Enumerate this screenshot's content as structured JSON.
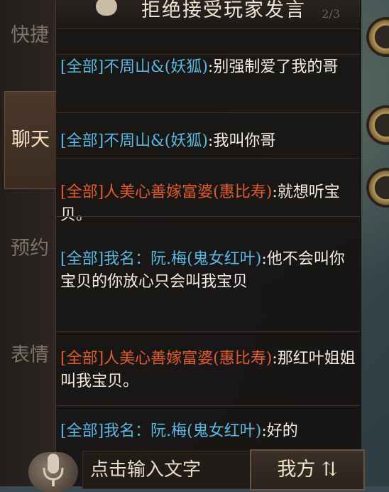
{
  "sidebar": {
    "tabs": [
      {
        "label": "快捷",
        "state": "inactive"
      },
      {
        "label": "聊天",
        "state": "active"
      },
      {
        "label": "预约",
        "state": "inactive"
      },
      {
        "label": "表情",
        "state": "inactive"
      }
    ]
  },
  "header": {
    "title": "拒绝接受玩家发言",
    "page_indicator": "2/3"
  },
  "messages": [
    {
      "channel": "[全部]",
      "sender": "不周山&(妖狐)",
      "sender_color": "blue",
      "text": ":别强制爱了我的哥"
    },
    {
      "channel": "[全部]",
      "sender": "不周山&(妖狐)",
      "sender_color": "blue",
      "text": ":我叫你哥"
    },
    {
      "channel": "[全部]",
      "sender": "人美心善嫁富婆(惠比寿)",
      "sender_color": "red",
      "text": ":就想听宝贝。"
    },
    {
      "channel": "[全部]",
      "sender": "我名：阮.梅(鬼女红叶)",
      "sender_color": "blue",
      "text": ":他不会叫你宝贝的你放心只会叫我宝贝"
    },
    {
      "channel": "[全部]",
      "sender": "人美心善嫁富婆(惠比寿)",
      "sender_color": "red",
      "text": ":那红叶姐姐叫我宝贝。"
    },
    {
      "channel": "[全部]",
      "sender": "我名：阮.梅(鬼女红叶)",
      "sender_color": "blue",
      "text": ":好的"
    }
  ],
  "input": {
    "placeholder": "点击输入文字",
    "send_label": "我方 ⇅"
  },
  "colors": {
    "channel_blue": "#5bb8e0",
    "sender_red": "#e05a32",
    "panel_bg": "#161211",
    "text": "#f1ebe2"
  }
}
